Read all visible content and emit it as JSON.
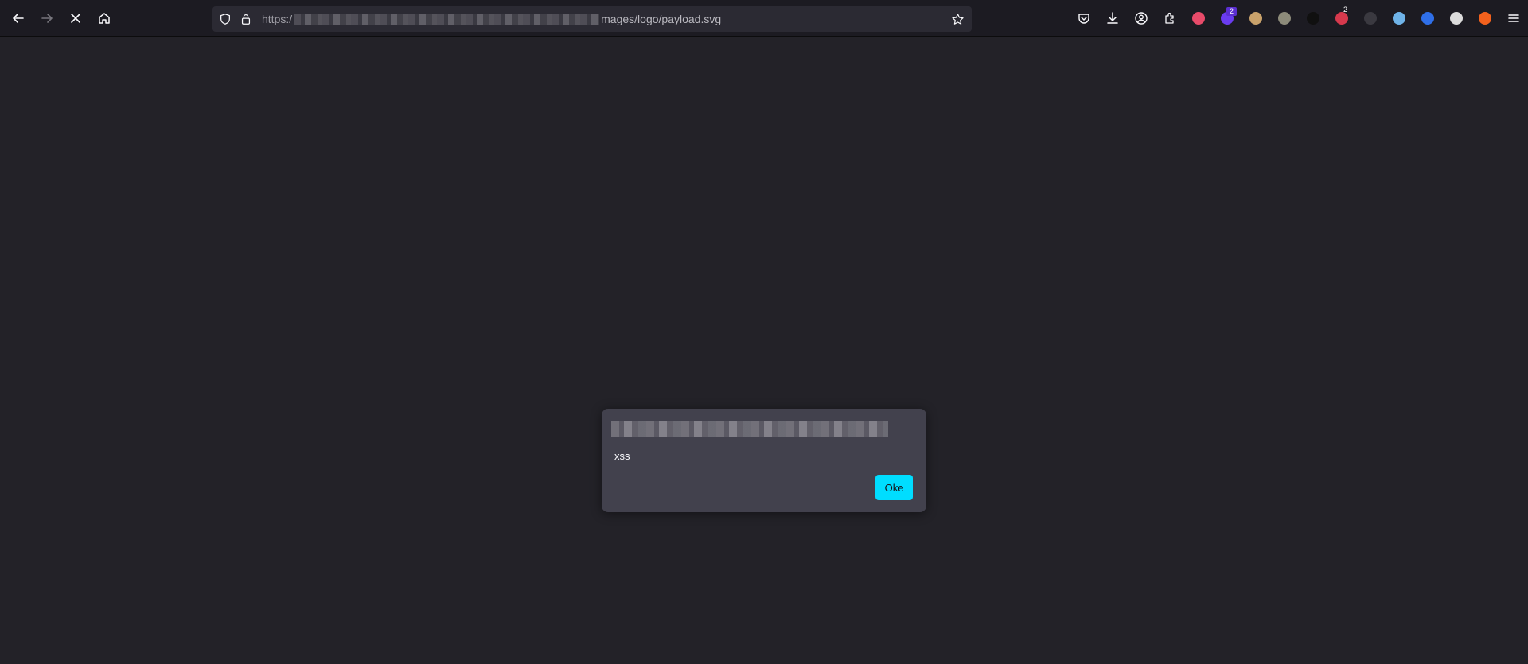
{
  "toolbar": {
    "url_prefix": "https:/",
    "url_suffix": "mages/logo/payload.svg",
    "extensions": [
      {
        "name": "extension-1-icon",
        "color": "#e84b6a",
        "badge": ""
      },
      {
        "name": "extension-2-icon",
        "color": "#6a3cf0",
        "badge": "2"
      },
      {
        "name": "extension-3-icon",
        "color": "#c9a26b",
        "badge": ""
      },
      {
        "name": "extension-4-icon",
        "color": "#8d8b7a",
        "badge": ""
      },
      {
        "name": "extension-5-icon",
        "color": "#101010",
        "badge": ""
      },
      {
        "name": "extension-6-icon",
        "color": "#d6394d",
        "badge": "2"
      },
      {
        "name": "extension-7-icon",
        "color": "#3a3940",
        "badge": ""
      },
      {
        "name": "extension-8-icon",
        "color": "#6fb3e8",
        "badge": ""
      },
      {
        "name": "extension-9-icon",
        "color": "#2f6fe8",
        "badge": ""
      },
      {
        "name": "extension-10-icon",
        "color": "#dcdcdc",
        "badge": ""
      },
      {
        "name": "extension-11-icon",
        "color": "#f2611d",
        "badge": ""
      }
    ]
  },
  "dialog": {
    "message": "xss",
    "ok_label": "Oke"
  },
  "colors": {
    "page_bg": "#232228",
    "toolbar_bg": "#1c1b22",
    "dialog_bg": "#42414d",
    "accent": "#00ddff"
  }
}
